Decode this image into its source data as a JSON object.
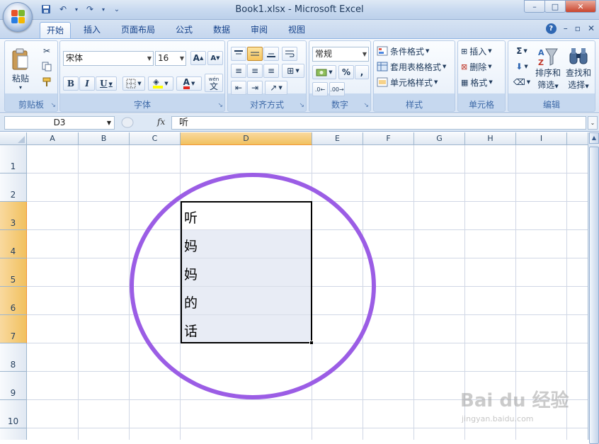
{
  "window": {
    "title": "Book1.xlsx - Microsoft Excel",
    "controls": {
      "minimize": "–",
      "maximize": "□",
      "close": "✕"
    }
  },
  "quick_access": {
    "more": "⌄"
  },
  "tabs": [
    {
      "label": "开始",
      "active": true
    },
    {
      "label": "插入"
    },
    {
      "label": "页面布局"
    },
    {
      "label": "公式"
    },
    {
      "label": "数据"
    },
    {
      "label": "审阅"
    },
    {
      "label": "视图"
    }
  ],
  "ribbon": {
    "clipboard": {
      "label": "剪贴板",
      "paste": "粘贴"
    },
    "font": {
      "label": "字体",
      "name": "宋体",
      "size": "16",
      "bold": "B",
      "italic": "I",
      "underline": "U",
      "grow": "A",
      "shrink": "A",
      "color_letter": "A",
      "wen": "wén",
      "wen_char": "文",
      "font_color": "#e5261e",
      "fill_color": "#ffff00"
    },
    "alignment": {
      "label": "对齐方式"
    },
    "number": {
      "label": "数字",
      "format": "常规",
      "percent": "%",
      "comma": ","
    },
    "styles": {
      "label": "样式",
      "conditional": "条件格式",
      "table": "套用表格格式",
      "cell": "单元格样式"
    },
    "cells": {
      "label": "单元格",
      "insert": "插入",
      "delete": "删除",
      "format": "格式"
    },
    "editing": {
      "label": "编辑",
      "sigma": "Σ",
      "sort": "排序和",
      "sort2": "筛选",
      "find": "查找和",
      "find2": "选择"
    }
  },
  "formula_bar": {
    "name_box": "D3",
    "fx": "fx",
    "content": "听"
  },
  "columns": [
    "A",
    "B",
    "C",
    "D",
    "E",
    "F",
    "G",
    "H",
    "I"
  ],
  "rows": [
    "1",
    "2",
    "3",
    "4",
    "5",
    "6",
    "7",
    "8",
    "9",
    "10"
  ],
  "cells": [
    {
      "ref": "D3",
      "value": "听"
    },
    {
      "ref": "D4",
      "value": "妈"
    },
    {
      "ref": "D5",
      "value": "妈"
    },
    {
      "ref": "D6",
      "value": "的"
    },
    {
      "ref": "D7",
      "value": "话"
    }
  ],
  "selection": {
    "range": "D3:D7",
    "highlight_color": "#f1c15f",
    "ring_color": "#9b5de5"
  },
  "watermark": {
    "brand": "Bai du 经验",
    "url": "jingyan.baidu.com"
  }
}
